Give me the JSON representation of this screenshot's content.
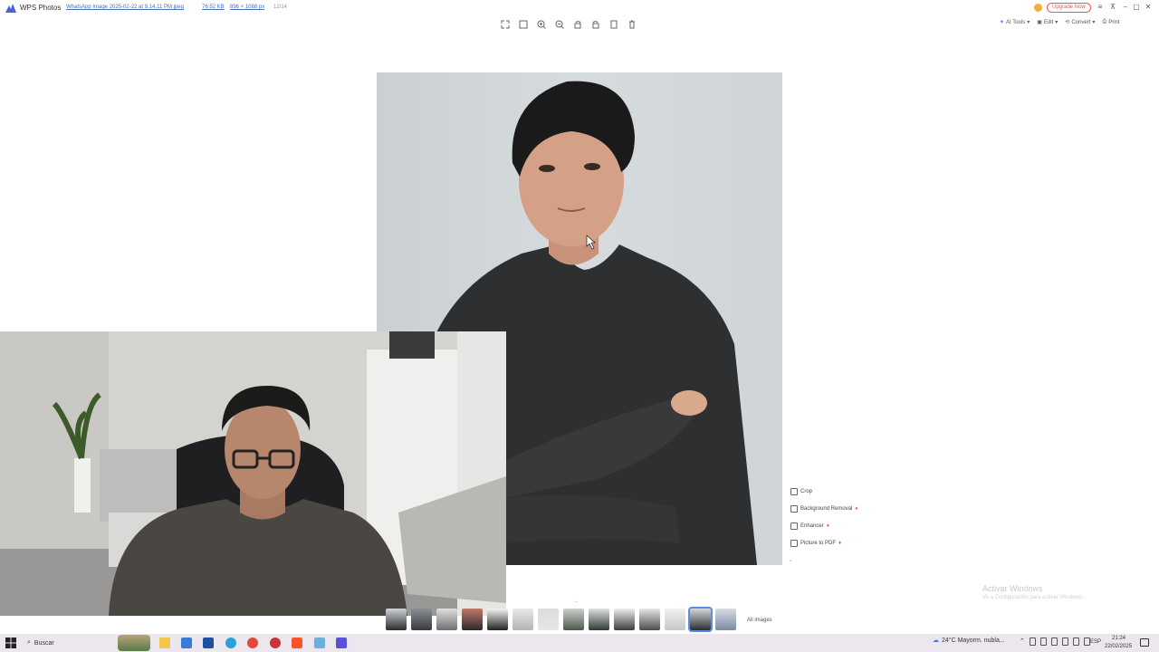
{
  "titlebar": {
    "app_name": "WPS Photos",
    "file_name": "WhatsApp Image 2025-02-22 at 9.14.11 PM.jpeg",
    "file_size": "76.52 KB",
    "dimensions": "896 × 1088 px",
    "index": "12/14",
    "upgrade_label": "Upgrade Now",
    "upgrade_color": "#e25a5a"
  },
  "right_tools": {
    "ai_tools": "AI Tools",
    "edit": "Edit",
    "convert": "Convert",
    "print": "Print"
  },
  "side_actions": [
    {
      "label": "Crop",
      "icon": "crop-icon"
    },
    {
      "label": "Background Removal",
      "icon": "background-removal-icon"
    },
    {
      "label": "Enhancer",
      "icon": "enhancer-icon"
    },
    {
      "label": "Picture to PDF",
      "icon": "pdf-icon"
    }
  ],
  "filmstrip": {
    "all_images_label": "All images",
    "selected_index": 12
  },
  "watermark": {
    "title": "Activar Windows",
    "subtitle": "Ve a Configuración para activar Windows."
  },
  "taskbar": {
    "search_label": "Buscar",
    "weather": "24°C  Mayorm. nubla...",
    "language": "ESP",
    "time": "21:24",
    "date": "22/02/2025"
  }
}
